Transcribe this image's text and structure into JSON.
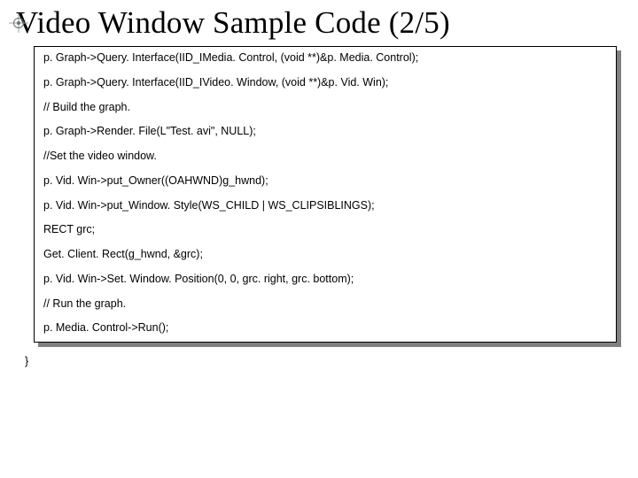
{
  "title": "Video Window Sample Code (2/5)",
  "code_lines": [
    "p. Graph->Query. Interface(IID_IMedia. Control, (void **)&p. Media. Control);",
    "p. Graph->Query. Interface(IID_IVideo. Window, (void **)&p. Vid. Win);",
    "// Build the graph.",
    "p. Graph->Render. File(L\"Test. avi\", NULL);",
    "//Set the video window.",
    "p. Vid. Win->put_Owner((OAHWND)g_hwnd);",
    "p. Vid. Win->put_Window. Style(WS_CHILD | WS_CLIPSIBLINGS);",
    "RECT grc;",
    "Get. Client. Rect(g_hwnd, &grc);",
    "p. Vid. Win->Set. Window. Position(0, 0, grc. right, grc. bottom);",
    "// Run the graph.",
    "p. Media. Control->Run();"
  ],
  "closing_brace": "}"
}
